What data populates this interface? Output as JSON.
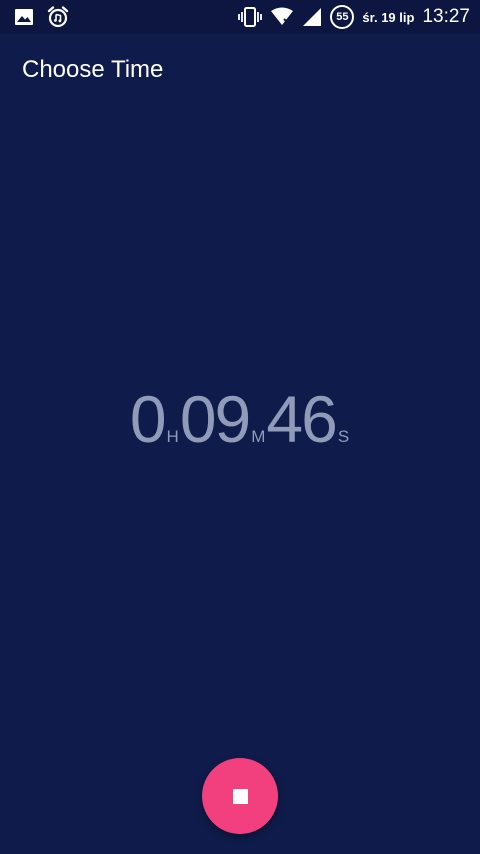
{
  "status_bar": {
    "left_icons": [
      "image-icon",
      "alarm-clock-icon"
    ],
    "right_icons": [
      "vibrate-icon",
      "wifi-icon",
      "cell-signal-icon",
      "battery-saver-icon"
    ],
    "battery_level": "55",
    "date": "śr. 19 lip",
    "time": "13:27"
  },
  "app_bar": {
    "title": "Choose Time"
  },
  "timer": {
    "hours": "0",
    "hours_unit": "H",
    "minutes": "09",
    "minutes_unit": "M",
    "seconds": "46",
    "seconds_unit": "S"
  },
  "fab": {
    "icon": "stop-icon",
    "color": "#f2407e"
  },
  "colors": {
    "background": "#0f1b4a",
    "status_bar": "#0c1640",
    "timer_text": "#8f9bb8",
    "accent": "#f2407e"
  }
}
